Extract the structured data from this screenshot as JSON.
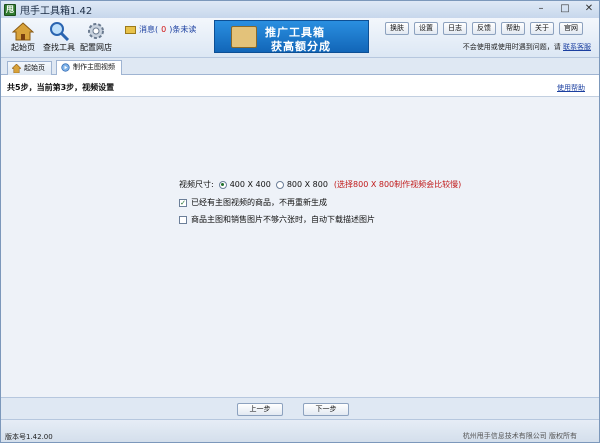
{
  "window": {
    "title": "甩手工具箱1.42",
    "app_icon_glyph": "甩",
    "controls": [
      "–",
      "□",
      "✕"
    ]
  },
  "toolbar": {
    "home_label": "起始页",
    "find_label": "查找工具",
    "config_label": "配置网店",
    "message_label": "消息(",
    "message_count": "0",
    "message_suffix": ")条未读",
    "banner_line1": "推广工具箱",
    "banner_line2": "获高额分成",
    "buttons": [
      "换肤",
      "设置",
      "日志",
      "反馈",
      "帮助",
      "关于",
      "官网"
    ],
    "notice_text": "不会使用或使用时遇到问题，请",
    "notice_link": "联系客服"
  },
  "tabs": [
    {
      "label": "起始页",
      "icon": "home-icon"
    },
    {
      "label": "制作主图视频",
      "icon": "video-icon"
    }
  ],
  "step": {
    "text": "共5步，当前第3步，视频设置",
    "help_link": "使用帮助"
  },
  "form": {
    "size_label": "视频尺寸:",
    "option_400": "400 X 400",
    "option_800": "800 X 800",
    "option_note": "(选择800 X 800制作视频会比较慢)",
    "selected": "400 X 400",
    "check1_label": "已经有主图视频的商品，不再重新生成",
    "check1_checked": true,
    "check2_label": "商品主图和销售图片不够六张时，自动下载描述图片",
    "check2_checked": false
  },
  "nav": {
    "prev_label": "上一步",
    "next_label": "下一步"
  },
  "status": {
    "version": "版本号1.42.00",
    "copyright": "杭州甩手信息技术有限公司 版权所有"
  },
  "colors": {
    "accent_blue": "#1b3fa0",
    "warning_red": "#c01818",
    "banner_blue": "#1266b8"
  }
}
